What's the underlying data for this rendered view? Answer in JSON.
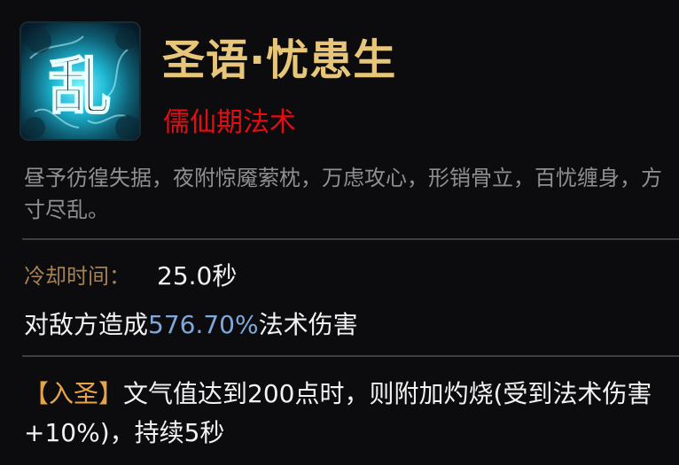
{
  "skill": {
    "icon_name": "chaos-glyph-icon",
    "icon_glyph": "乱",
    "name": "圣语·忧患生",
    "category": "儒仙期法术",
    "description": "昼予彷徨失据，夜附惊魇萦枕，万虑攻心，形销骨立，百忧缠身，方寸尽乱。",
    "cooldown_label": "冷却时间：",
    "cooldown_value": "25.0秒",
    "damage_prefix": "对敌方造成",
    "damage_value": "576.70%",
    "damage_suffix": "法术伤害",
    "passive_tag": "【入圣】",
    "passive_text": "文气值达到200点时，则附加灼烧(受到法术伤害+10%)，持续5秒"
  },
  "colors": {
    "title": "#e8c679",
    "category": "#e40d12",
    "highlight": "#7ea9dc",
    "tag": "#e6a44a",
    "label": "#a68152"
  }
}
